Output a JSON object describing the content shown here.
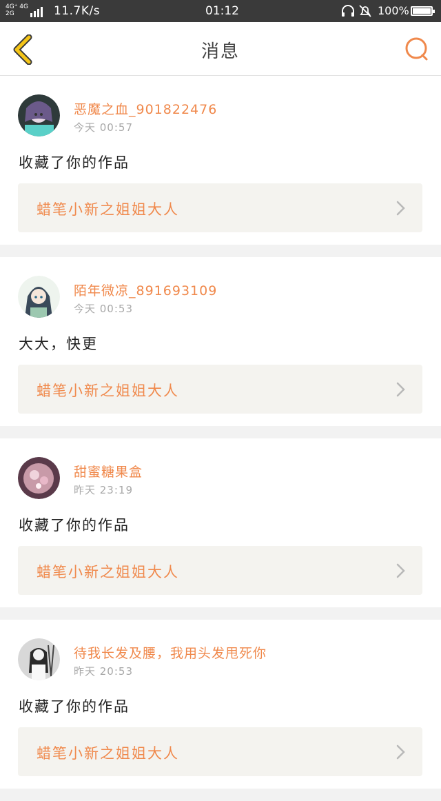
{
  "status_bar": {
    "network": "4G⁺ 4G\n2G",
    "speed": "11.7K/s",
    "time": "01:12",
    "battery": "100%"
  },
  "header": {
    "title": "消息"
  },
  "colors": {
    "accent": "#f0894c",
    "back_arrow": "#f5c518",
    "card_bg": "#ffffff",
    "work_bg": "#f4f3ef"
  },
  "messages": [
    {
      "user": "恶魔之血_901822476",
      "time": "今天 00:57",
      "text": "收藏了你的作品",
      "work": "蜡笔小新之姐姐大人"
    },
    {
      "user": "陌年微凉_891693109",
      "time": "今天 00:53",
      "text": "大大，快更",
      "work": "蜡笔小新之姐姐大人"
    },
    {
      "user": "甜蜜糖果盒",
      "time": "昨天 23:19",
      "text": "收藏了你的作品",
      "work": "蜡笔小新之姐姐大人"
    },
    {
      "user": "待我长发及腰，我用头发甩死你",
      "time": "昨天 20:53",
      "text": "收藏了你的作品",
      "work": "蜡笔小新之姐姐大人"
    }
  ]
}
